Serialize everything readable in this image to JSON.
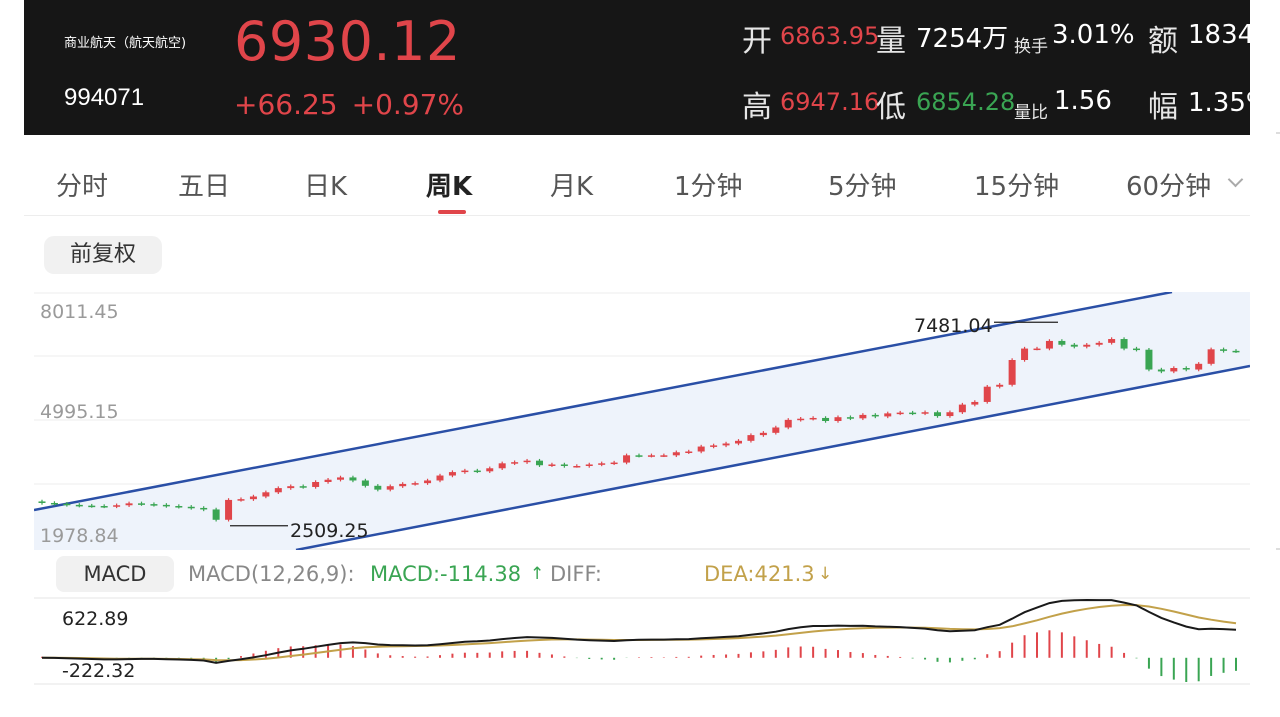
{
  "header": {
    "name": "商业航天（航天航空)",
    "code": "994071",
    "price": "6930.12",
    "change": "+66.25",
    "change_pct": "+0.97%",
    "open_label": "开",
    "open": "6863.95",
    "volume_label": "量",
    "volume": "7254万",
    "turnover_label": "换手",
    "turnover": "3.01%",
    "amount_label": "额",
    "amount": "1834",
    "high_label": "高",
    "high": "6947.16",
    "low_label": "低",
    "low": "6854.28",
    "vol_ratio_label": "量比",
    "vol_ratio": "1.56",
    "amplitude_label": "幅",
    "amplitude": "1.35%"
  },
  "tabs": [
    "分时",
    "五日",
    "日K",
    "周K",
    "月K",
    "1分钟",
    "5分钟",
    "15分钟",
    "60分钟"
  ],
  "active_tab": "周K",
  "adjust_label": "前复权",
  "chart_data": {
    "type": "candlestick",
    "y_labels": [
      "8011.45",
      "4995.15",
      "1978.84"
    ],
    "ylim": [
      1978.84,
      8011.45
    ],
    "annotations": [
      {
        "label": "7481.04",
        "value": 7481.04
      },
      {
        "label": "2509.25",
        "value": 2509.25
      }
    ],
    "channel": true,
    "colors": {
      "up": "#e0454a",
      "down": "#3aa553",
      "channel": "#2a4fa6",
      "channel_fill": "#eef3fb"
    },
    "closes": [
      2950,
      2930,
      2900,
      2880,
      2870,
      2860,
      2890,
      2940,
      2920,
      2900,
      2870,
      2850,
      2820,
      2780,
      2509.25,
      3030,
      3050,
      3120,
      3230,
      3340,
      3390,
      3370,
      3500,
      3560,
      3620,
      3540,
      3400,
      3300,
      3390,
      3450,
      3470,
      3540,
      3670,
      3760,
      3800,
      3780,
      3860,
      3990,
      4020,
      4060,
      3940,
      3960,
      3920,
      3920,
      3960,
      3990,
      4010,
      4200,
      4190,
      4200,
      4200,
      4280,
      4300,
      4430,
      4460,
      4510,
      4580,
      4730,
      4790,
      4930,
      5130,
      5160,
      5180,
      5100,
      5200,
      5170,
      5260,
      5220,
      5300,
      5320,
      5300,
      5330,
      5230,
      5330,
      5530,
      5600,
      6000,
      6050,
      6700,
      7000,
      7000,
      7200,
      7100,
      7050,
      7100,
      7150,
      7250,
      7000,
      6970,
      6450,
      6400,
      6490,
      6450,
      6600,
      6980,
      6940,
      6930.12
    ],
    "macd": {
      "labels": [
        "622.89",
        "-222.32"
      ],
      "title": "MACD",
      "params": "MACD(12,26,9):",
      "macd_text": "MACD:-114.38",
      "diff_text": "DIFF:",
      "dea_text": "DEA:421.3",
      "colors": {
        "diff": "#1a1a1a",
        "dea": "#c2a14a",
        "up": "#e0454a",
        "down": "#3aa553"
      }
    }
  }
}
